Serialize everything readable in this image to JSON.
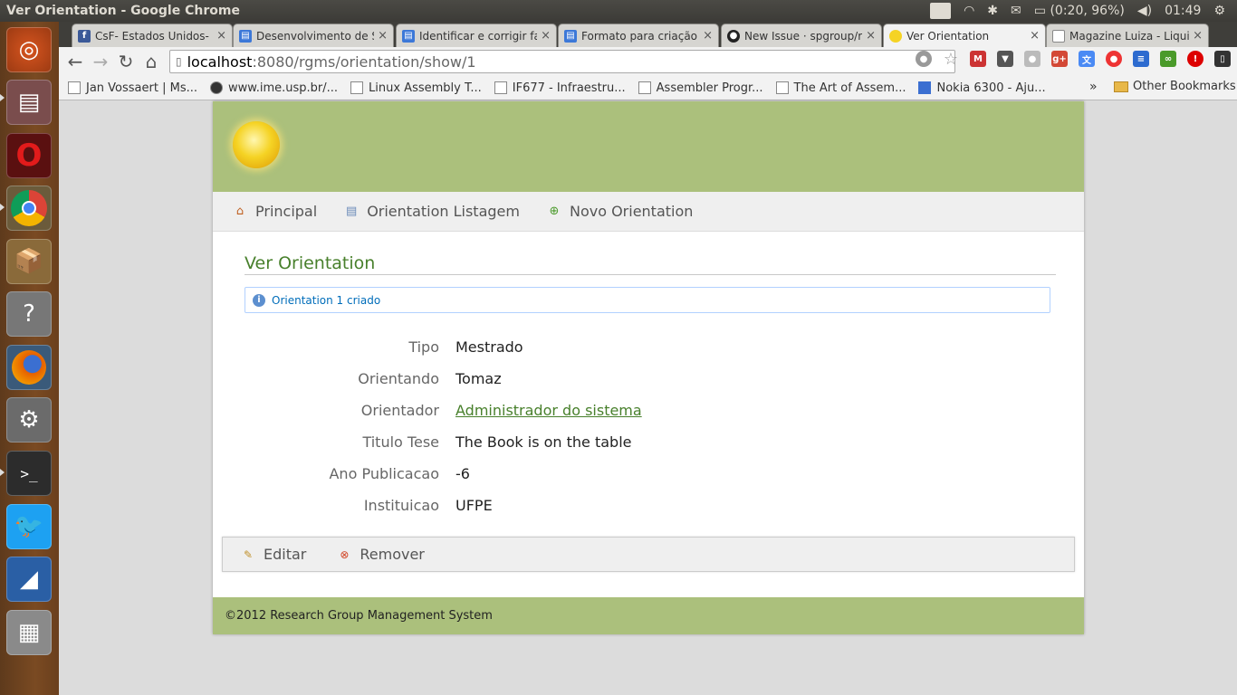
{
  "window": {
    "title": "Ver Orientation - Google Chrome"
  },
  "tray": {
    "keyboard": "Pt",
    "battery": "(0:20, 96%)",
    "clock": "01:49"
  },
  "tabs": [
    {
      "title": "CsF- Estados Unidos- Ec",
      "favicon": "facebook-icon"
    },
    {
      "title": "Desenvolvimento de Sc",
      "favicon": "document-icon"
    },
    {
      "title": "Identificar e corrigir fa",
      "favicon": "document-icon"
    },
    {
      "title": "Formato para criação d",
      "favicon": "document-icon"
    },
    {
      "title": "New Issue · spgroup/rg",
      "favicon": "github-icon"
    },
    {
      "title": "Ver Orientation",
      "favicon": "sun-icon"
    },
    {
      "title": "Magazine Luiza - Liquid",
      "favicon": "page-icon"
    }
  ],
  "omnibox": {
    "host": "localhost",
    "path": ":8080/rgms/orientation/show/1"
  },
  "bookmarks": [
    "Jan Vossaert | Ms...",
    "www.ime.usp.br/...",
    "Linux Assembly T...",
    "IF677 - Infraestru...",
    "Assembler Progr...",
    "The Art of Assem...",
    "Nokia 6300 - Aju..."
  ],
  "bookmarks_more": "»",
  "other_bookmarks": "Other Bookmarks",
  "app": {
    "nav": {
      "home": "Principal",
      "list": "Orientation Listagem",
      "create": "Novo Orientation"
    },
    "heading": "Ver Orientation",
    "message": "Orientation 1 criado",
    "properties": [
      {
        "label": "Tipo",
        "value": "Mestrado"
      },
      {
        "label": "Orientando",
        "value": "Tomaz"
      },
      {
        "label": "Orientador",
        "value": "Administrador do sistema"
      },
      {
        "label": "Titulo Tese",
        "value": "The Book is on the table"
      },
      {
        "label": "Ano Publicacao",
        "value": "-6"
      },
      {
        "label": "Instituicao",
        "value": "UFPE"
      }
    ],
    "buttons": {
      "edit": "Editar",
      "delete": "Remover"
    },
    "footer": "©2012 Research Group Management System"
  }
}
